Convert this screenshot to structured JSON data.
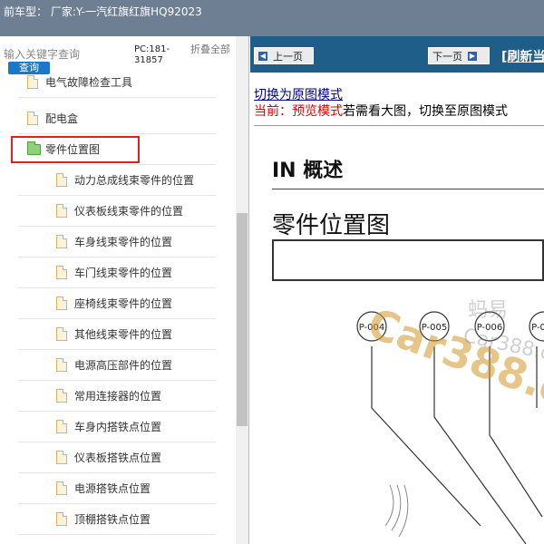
{
  "header": {
    "title": "前车型：  厂家:Y-一汽红旗红旗HQ92023"
  },
  "sidebar": {
    "search": {
      "placeholder": "输入关键字查询",
      "button_label": "查询"
    },
    "pc_code": "PC:181-31857",
    "collapse_label": "折叠全部",
    "items": [
      {
        "label": "电气故障检查工具",
        "level": 1
      },
      {
        "label": "配电盒",
        "level": 1
      },
      {
        "label": "零件位置图",
        "level": 1,
        "folder": true,
        "selected": true
      },
      {
        "label": "动力总成线束零件的位置",
        "level": 2
      },
      {
        "label": "仪表板线束零件的位置",
        "level": 2
      },
      {
        "label": "车身线束零件的位置",
        "level": 2
      },
      {
        "label": "车门线束零件的位置",
        "level": 2
      },
      {
        "label": "座椅线束零件的位置",
        "level": 2
      },
      {
        "label": "其他线束零件的位置",
        "level": 2
      },
      {
        "label": "电源高压部件的位置",
        "level": 2
      },
      {
        "label": "常用连接器的位置",
        "level": 2
      },
      {
        "label": "车身内搭铁点位置",
        "level": 2
      },
      {
        "label": "仪表板搭铁点位置",
        "level": 2
      },
      {
        "label": "电源搭铁点位置",
        "level": 2
      },
      {
        "label": "顶棚搭铁点位置",
        "level": 2
      }
    ]
  },
  "toolbar": {
    "prev_label": "上一页",
    "next_label": "下一页",
    "refresh_label": "[刷新当"
  },
  "viewer": {
    "mode_link": "切换为原图模式",
    "current_prefix": "当前：预览模式",
    "current_rest": "若需看大图，切换至原图模式"
  },
  "document": {
    "section": "IN 概述",
    "title": "零件位置图",
    "connectors": [
      "P-004",
      "P-005",
      "P-006",
      "P-0"
    ],
    "watermarks": [
      "蚂易",
      "Car388.cn",
      "Car388.c",
      "CP.01"
    ]
  },
  "colors": {
    "topbar": "#6e7f94",
    "nav_bar": "#1f5e88",
    "selected_outline": "#e02020",
    "mode_current": "#e00000",
    "link": "#000080"
  }
}
